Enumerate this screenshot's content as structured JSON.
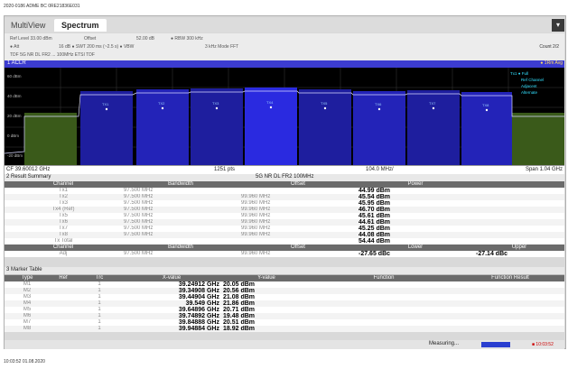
{
  "top_caption": "2020-0186 ADME BC 0RE21836E031",
  "bottom_caption": "10:03:52  01.08.2020",
  "tabs": {
    "multiview": "MultiView",
    "spectrum": "Spectrum",
    "corner": "▾"
  },
  "params": {
    "ref_level": "Ref Level 33.00 dBm",
    "offset": "Offset",
    "offset_val": "52.00 dB",
    "rbw": "● RBW 300 kHz",
    "att": "● Att",
    "att_val": "16 dB ● SWT  200 ms (~2.5 s) ● VBW",
    "vbw_val": "3 kHz  Mode  FFT",
    "extra": "TDF  5G NR  DL FR2 ... 100MHz  ETSI  TDF",
    "count": "Count 2/2"
  },
  "aclr": {
    "title": "1 ACLR",
    "badge": "● 1Rm Avg",
    "legend_lines": [
      "Tx1 ● Full",
      "Ref Channel",
      "Adjacent",
      "Alternate"
    ],
    "cf": "CF 39.60012 GHz",
    "pts": "1251 pts",
    "per_div": "104.0 MHz/",
    "span": "Span 1.04 GHz",
    "y_labels": [
      "60 dBm",
      "40 dBm",
      "20 dBm",
      "0 dBm",
      "-20 dBm"
    ],
    "channel_labels": [
      "TX1",
      "TX2",
      "TX3",
      "TX4",
      "TX5",
      "TX6",
      "TX7",
      "TX8"
    ]
  },
  "result_summary": {
    "title": "2 Result Summary",
    "header_center": "5G NR DL FR2 100MHz",
    "columns": [
      "Channel",
      "Bandwidth",
      "Offset",
      "Power"
    ],
    "rows": [
      {
        "channel": "Tx1",
        "bandwidth": "97.500 MHz",
        "offset": "",
        "power": "44.99 dBm"
      },
      {
        "channel": "Tx2",
        "bandwidth": "97.500 MHz",
        "offset": "99.960 MHz",
        "power": "45.54 dBm"
      },
      {
        "channel": "Tx3",
        "bandwidth": "97.500 MHz",
        "offset": "99.960 MHz",
        "power": "45.95 dBm"
      },
      {
        "channel": "Tx4 (Ref)",
        "bandwidth": "97.500 MHz",
        "offset": "99.960 MHz",
        "power": "46.70 dBm"
      },
      {
        "channel": "Tx5",
        "bandwidth": "97.500 MHz",
        "offset": "99.960 MHz",
        "power": "45.61 dBm"
      },
      {
        "channel": "Tx6",
        "bandwidth": "97.500 MHz",
        "offset": "99.960 MHz",
        "power": "44.61 dBm"
      },
      {
        "channel": "Tx7",
        "bandwidth": "97.500 MHz",
        "offset": "99.960 MHz",
        "power": "45.25 dBm"
      },
      {
        "channel": "Tx8",
        "bandwidth": "97.500 MHz",
        "offset": "99.960 MHz",
        "power": "44.08 dBm"
      },
      {
        "channel": "Tx Total",
        "bandwidth": "",
        "offset": "",
        "power": "54.44 dBm"
      }
    ],
    "adj_columns": [
      "Channel",
      "Bandwidth",
      "Offset",
      "Lower",
      "Upper"
    ],
    "adj_row": {
      "channel": "Adj",
      "bandwidth": "97.500 MHz",
      "offset": "99.960 MHz",
      "lower": "-27.65 dBc",
      "upper": "-27.14 dBc"
    }
  },
  "marker_table": {
    "title": "3 Marker Table",
    "columns": [
      "Type",
      "Ref",
      "Trc",
      "X-value",
      "Y-value",
      "Function",
      "Function Result"
    ],
    "rows": [
      {
        "type": "M1",
        "trc": "1",
        "x": "39.24912 GHz",
        "y": "20.05 dBm"
      },
      {
        "type": "M2",
        "trc": "1",
        "x": "39.34908 GHz",
        "y": "20.56 dBm"
      },
      {
        "type": "M3",
        "trc": "1",
        "x": "39.44904 GHz",
        "y": "21.08 dBm"
      },
      {
        "type": "M4",
        "trc": "1",
        "x": "39.549 GHz",
        "y": "21.86 dBm"
      },
      {
        "type": "M5",
        "trc": "1",
        "x": "39.64896 GHz",
        "y": "20.71 dBm"
      },
      {
        "type": "M6",
        "trc": "1",
        "x": "39.74892 GHz",
        "y": "19.48 dBm"
      },
      {
        "type": "M7",
        "trc": "1",
        "x": "39.84888 GHz",
        "y": "20.51 dBm"
      },
      {
        "type": "M8",
        "trc": "1",
        "x": "39.94884 GHz",
        "y": "18.92 dBm"
      }
    ]
  },
  "status": {
    "measuring": "Measuring...",
    "right": "■ 10:03:52"
  },
  "colors": {
    "ref_channel": "#2a2ae0",
    "tx_channel": "#1e1e9e",
    "adjacent": "#3a5a1a",
    "plot_bg": "#000000"
  }
}
